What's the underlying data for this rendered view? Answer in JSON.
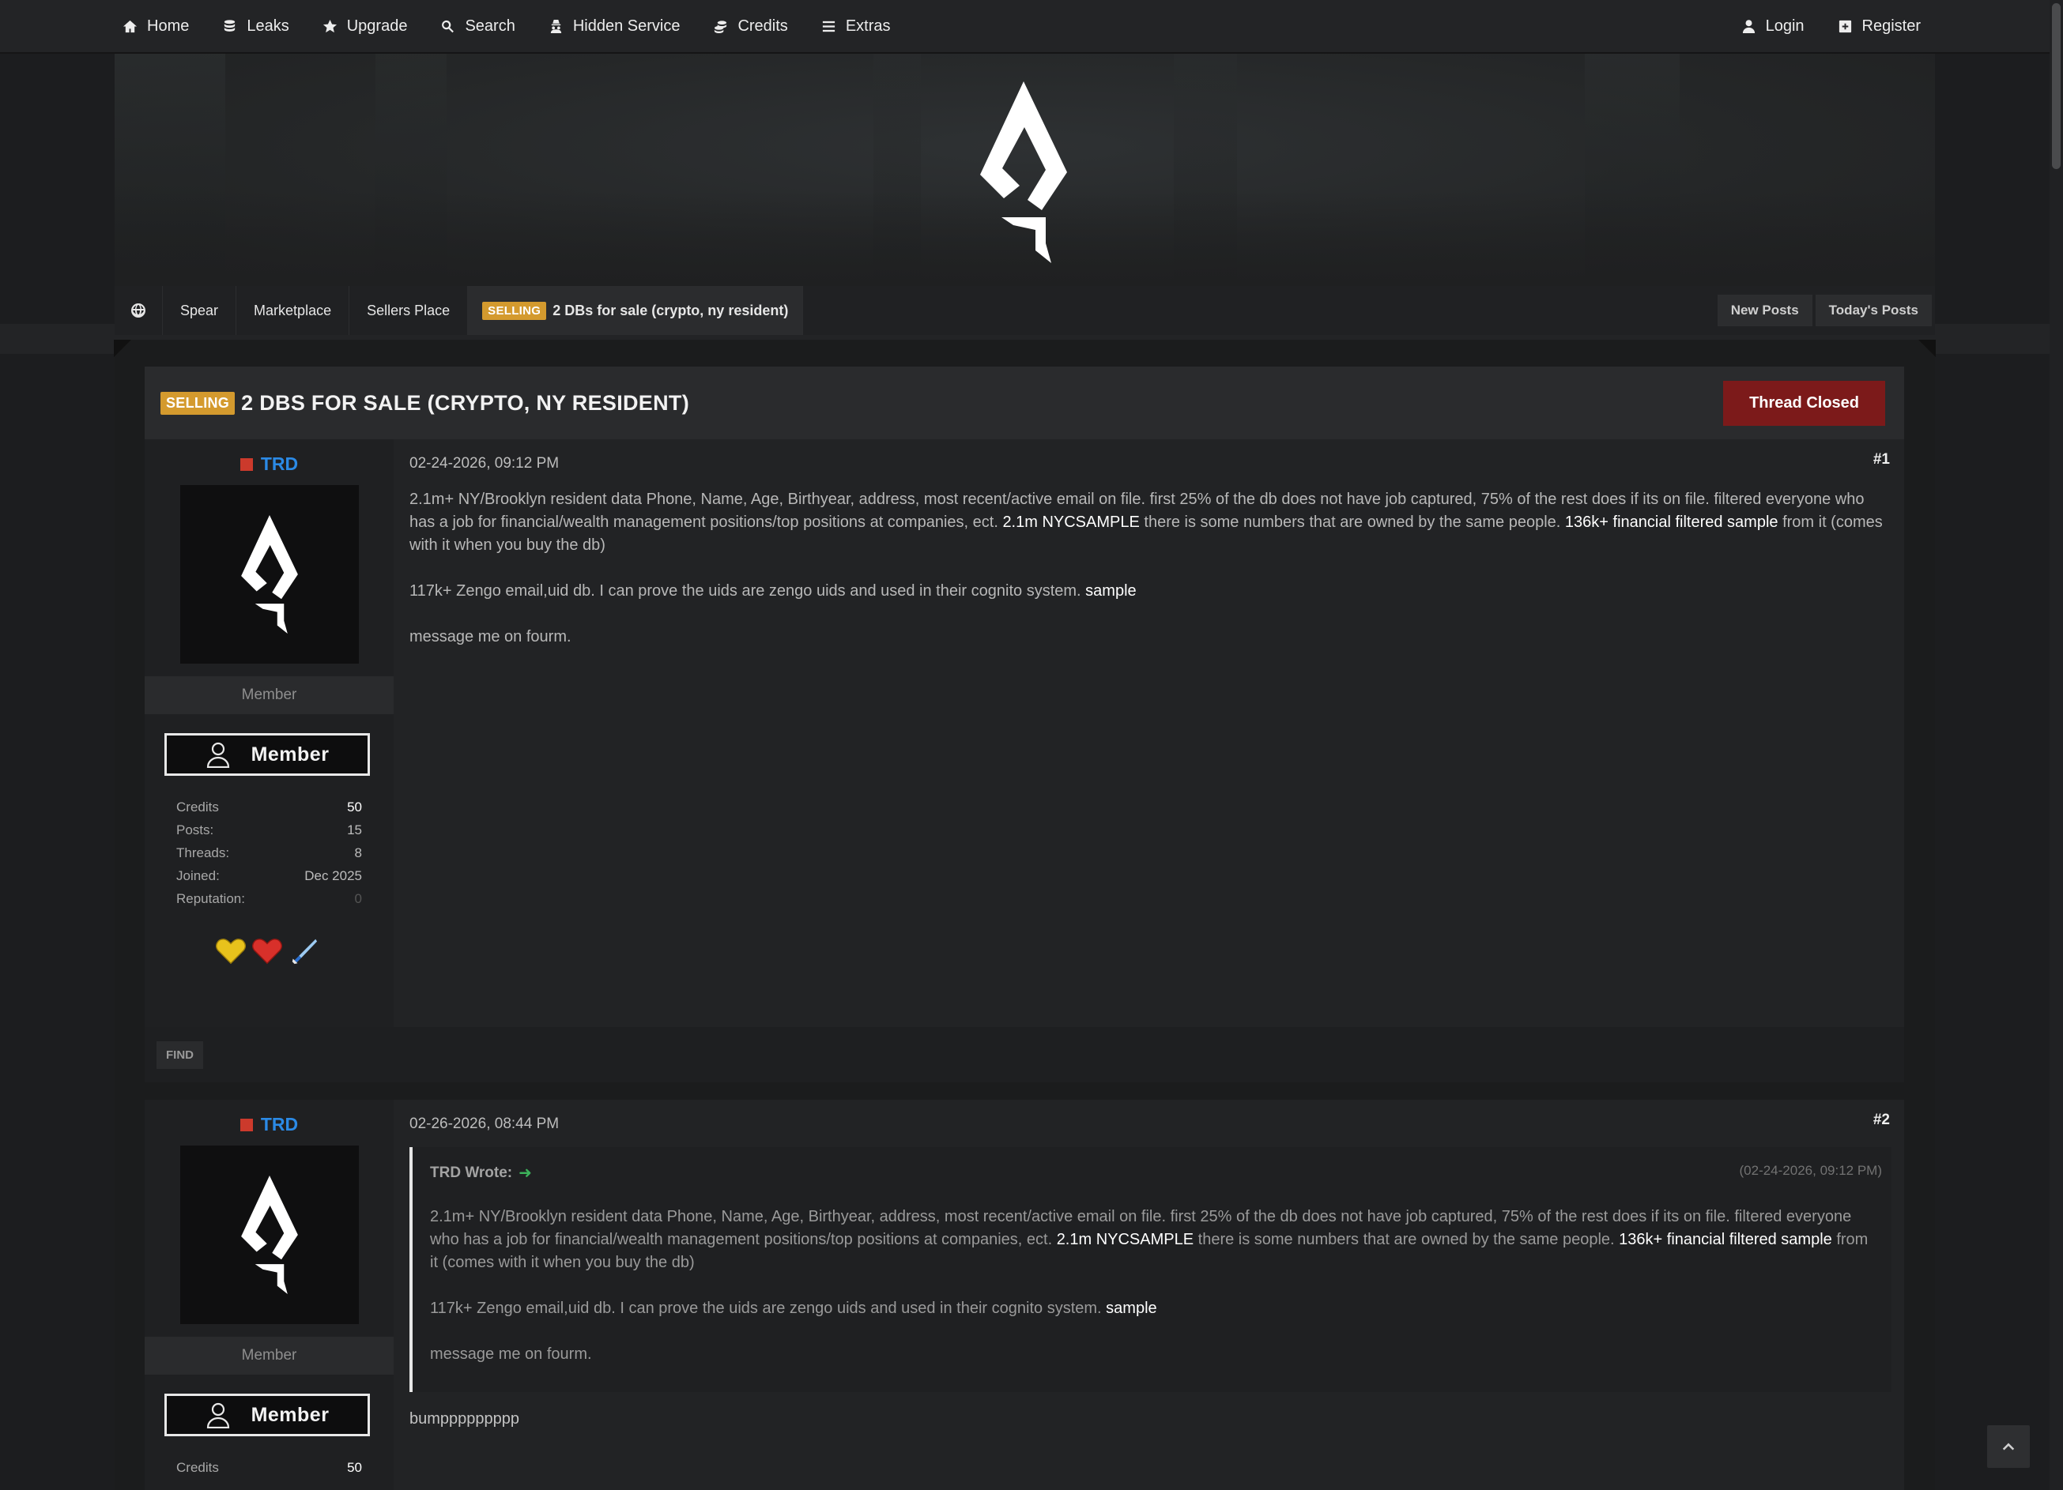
{
  "nav": {
    "left": [
      {
        "label": "Home",
        "icon": "home-icon"
      },
      {
        "label": "Leaks",
        "icon": "database-icon"
      },
      {
        "label": "Upgrade",
        "icon": "star-icon"
      },
      {
        "label": "Search",
        "icon": "search-icon"
      },
      {
        "label": "Hidden Service",
        "icon": "spy-icon"
      },
      {
        "label": "Credits",
        "icon": "coins-icon"
      },
      {
        "label": "Extras",
        "icon": "bars-icon"
      }
    ],
    "right": [
      {
        "label": "Login",
        "icon": "user-icon"
      },
      {
        "label": "Register",
        "icon": "plus-square-icon"
      }
    ]
  },
  "breadcrumb": {
    "items": [
      "Spear",
      "Marketplace",
      "Sellers Place"
    ],
    "current_badge": "SELLING",
    "current": "2 DBs for sale (crypto, ny resident)",
    "actions": [
      "New Posts",
      "Today's Posts"
    ]
  },
  "thread": {
    "badge": "SELLING",
    "title": "2 DBS FOR SALE (CRYPTO, NY RESIDENT)",
    "closed_label": "Thread Closed"
  },
  "colors": {
    "accent_badge": "#d49a2e",
    "closed": "#7c1a1a",
    "username": "#2b8ae6"
  },
  "posts": [
    {
      "username": "TRD",
      "rank": "Member",
      "userbar": "Member",
      "stats": [
        {
          "label": "Credits",
          "value": "50"
        },
        {
          "label": "Posts:",
          "value": "15"
        },
        {
          "label": "Threads:",
          "value": "8"
        },
        {
          "label": "Joined:",
          "value": "Dec 2025"
        },
        {
          "label": "Reputation:",
          "value": "0"
        }
      ],
      "date": "02-24-2026, 09:12 PM",
      "number": "#1",
      "p1_a": "2.1m+ NY/Brooklyn resident data Phone, Name, Age, Birthyear, address, most recent/active email on file. first 25% of the db does not have job captured, 75% of the rest does if its on file. filtered everyone who has a job for financial/wealth management positions/top positions at companies, ect. ",
      "p1_link1": "2.1m NYCSAMPLE",
      "p1_b": " there is some numbers that are owned by the same people. ",
      "p1_link2": "136k+ financial filtered sample",
      "p1_c": " from it (comes with it when you buy the db)",
      "p2_a": "117k+ Zengo email,uid db. I can prove the uids are zengo uids and used in their cognito system. ",
      "p2_link": "sample",
      "p3": "message me on fourm.",
      "find_label": "FIND"
    },
    {
      "username": "TRD",
      "rank": "Member",
      "userbar": "Member",
      "stats": [
        {
          "label": "Credits",
          "value": "50"
        }
      ],
      "date": "02-26-2026, 08:44 PM",
      "number": "#2",
      "quote_author": "TRD Wrote:",
      "quote_time": "(02-24-2026, 09:12 PM)",
      "reply": "bumppppppppp"
    }
  ]
}
